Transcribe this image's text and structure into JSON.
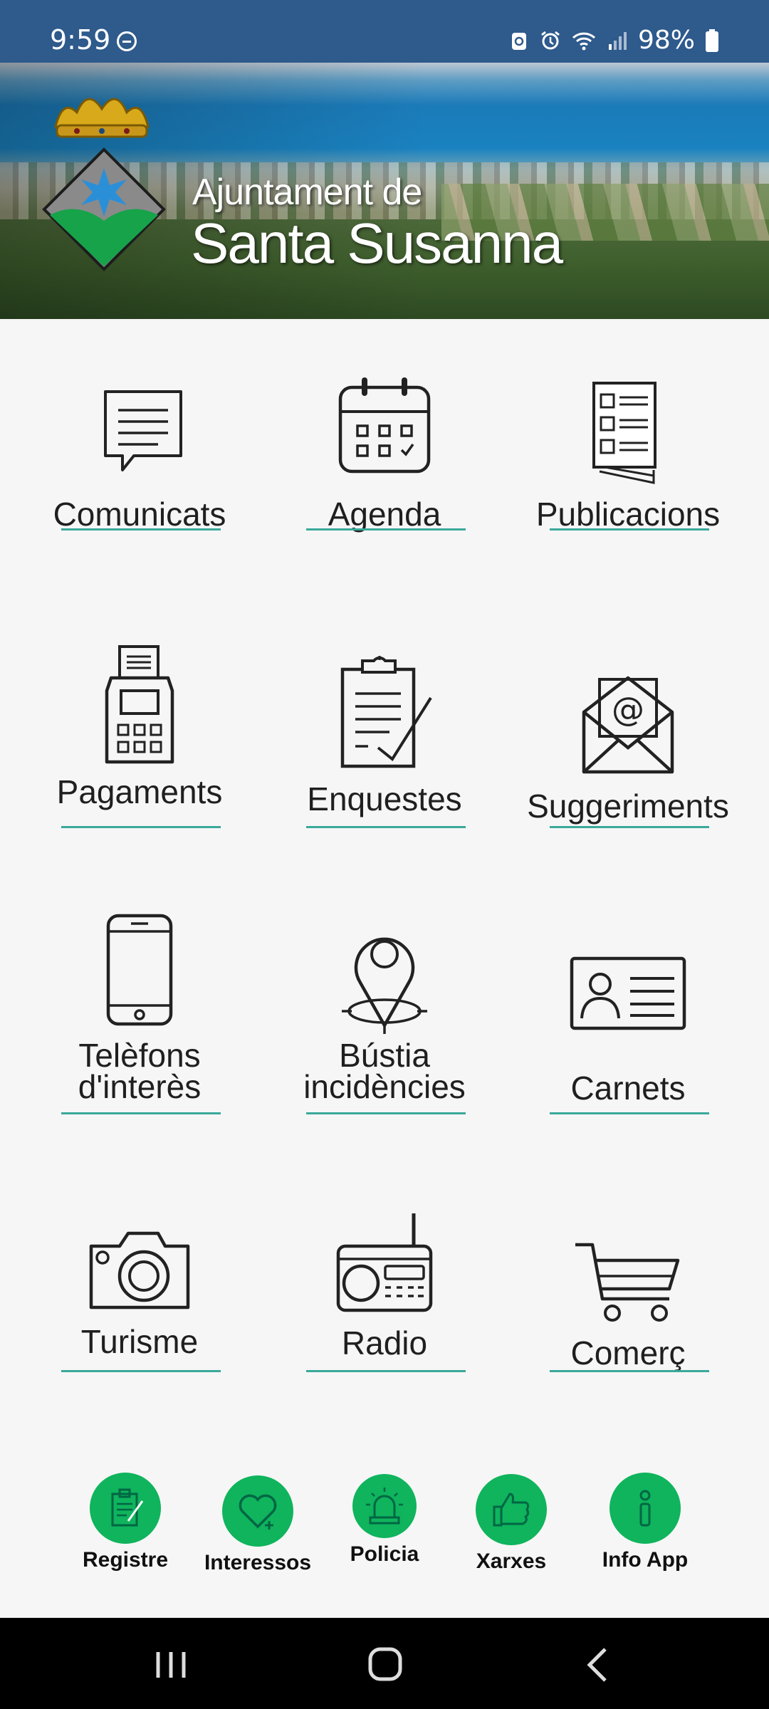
{
  "status_bar": {
    "time": "9:59",
    "battery": "98%"
  },
  "header": {
    "line1": "Ajuntament de",
    "line2": "Santa Susanna"
  },
  "grid": [
    {
      "label": "Comunicats",
      "icon": "speech-bubble-icon"
    },
    {
      "label": "Agenda",
      "icon": "calendar-icon"
    },
    {
      "label": "Publicacions",
      "icon": "document-list-icon"
    },
    {
      "label": "Pagaments",
      "icon": "payment-terminal-icon"
    },
    {
      "label": "Enquestes",
      "icon": "clipboard-check-icon"
    },
    {
      "label": "Suggeriments",
      "icon": "envelope-at-icon"
    },
    {
      "label_line1": "Telèfons",
      "label_line2": "d'interès",
      "icon": "smartphone-icon"
    },
    {
      "label_line1": "Bústia",
      "label_line2": "incidències",
      "icon": "location-pin-icon"
    },
    {
      "label": "Carnets",
      "icon": "id-card-icon"
    },
    {
      "label": "Turisme",
      "icon": "camera-icon"
    },
    {
      "label": "Radio",
      "icon": "radio-icon"
    },
    {
      "label": "Comerç",
      "icon": "shopping-cart-icon"
    }
  ],
  "quick_actions": [
    {
      "label": "Registre",
      "icon": "register-clipboard-icon"
    },
    {
      "label": "Interessos",
      "icon": "heart-plus-icon"
    },
    {
      "label": "Policia",
      "icon": "siren-icon"
    },
    {
      "label": "Xarxes",
      "icon": "thumbs-up-icon"
    },
    {
      "label": "Info App",
      "icon": "info-icon"
    }
  ],
  "colors": {
    "status_bar": "#2e5a8c",
    "accent_line": "#3aa99a",
    "quick_green": "#0fb45c"
  }
}
